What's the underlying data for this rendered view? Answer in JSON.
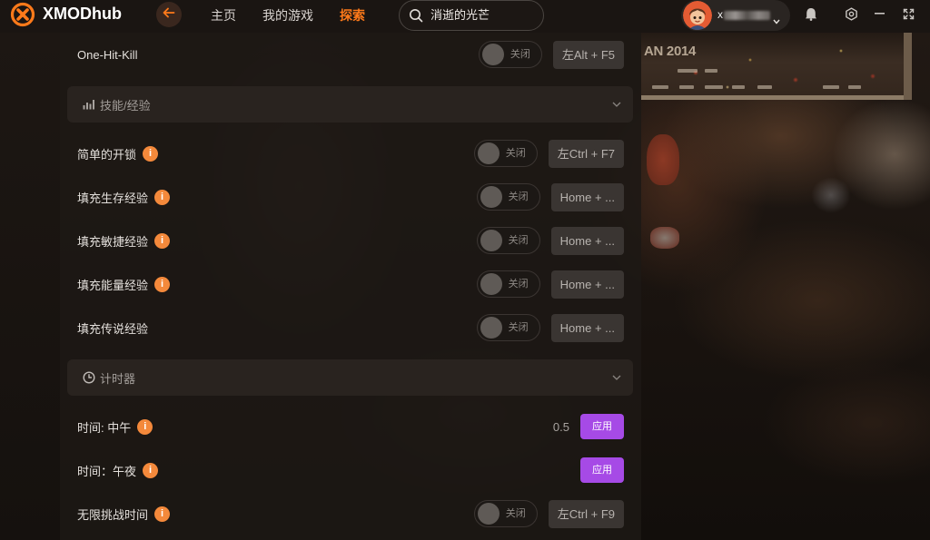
{
  "theme": {
    "accent": "#ff7a1a",
    "apply_button": "#a64ae6",
    "info_badge": "#f4893b"
  },
  "app": {
    "brand": "XMODhub",
    "logo_icon": "xmod-logo-icon"
  },
  "nav": {
    "back_icon": "back-arrow-icon",
    "items": [
      {
        "label": "主页",
        "active": false
      },
      {
        "label": "我的游戏",
        "active": false
      },
      {
        "label": "探索",
        "active": true
      }
    ]
  },
  "search": {
    "icon": "search-icon",
    "value": "消逝的光芒"
  },
  "user": {
    "avatar": "cartoon-avatar",
    "name_visible": "x",
    "name_redacted": true,
    "menu_icon": "chevron-down-icon"
  },
  "window_controls": {
    "icons": [
      "bell-icon",
      "settings-icon",
      "minimize-icon",
      "fullscreen-icon"
    ]
  },
  "background": {
    "poster_text": "AN 2014"
  },
  "cheats": {
    "info_glyph": "i",
    "top_row": {
      "label": "One-Hit-Kill",
      "toggle": "关闭",
      "on": false,
      "hotkey": "左Alt + F5"
    },
    "sections": [
      {
        "title": "技能/经验",
        "icon": "bar-chart-icon",
        "expanded": true,
        "rows": [
          {
            "label": "简单的开锁",
            "info": true,
            "toggle": "关闭",
            "on": false,
            "hotkey": "左Ctrl + F7"
          },
          {
            "label": "填充生存经验",
            "info": true,
            "toggle": "关闭",
            "on": false,
            "hotkey": "Home + ..."
          },
          {
            "label": "填充敏捷经验",
            "info": true,
            "toggle": "关闭",
            "on": false,
            "hotkey": "Home + ..."
          },
          {
            "label": "填充能量经验",
            "info": true,
            "toggle": "关闭",
            "on": false,
            "hotkey": "Home + ..."
          },
          {
            "label": "填充传说经验",
            "info": false,
            "toggle": "关闭",
            "on": false,
            "hotkey": "Home + ..."
          }
        ]
      },
      {
        "title": "计时器",
        "icon": "clock-icon",
        "expanded": true,
        "rows": [
          {
            "label": "时间: 中午",
            "info": true,
            "value": "0.5",
            "button": "应用"
          },
          {
            "label": "时间：午夜",
            "info": true,
            "button": "应用"
          },
          {
            "label": "无限挑战时间",
            "info": true,
            "toggle": "关闭",
            "on": false,
            "hotkey": "左Ctrl + F9"
          }
        ]
      }
    ]
  }
}
